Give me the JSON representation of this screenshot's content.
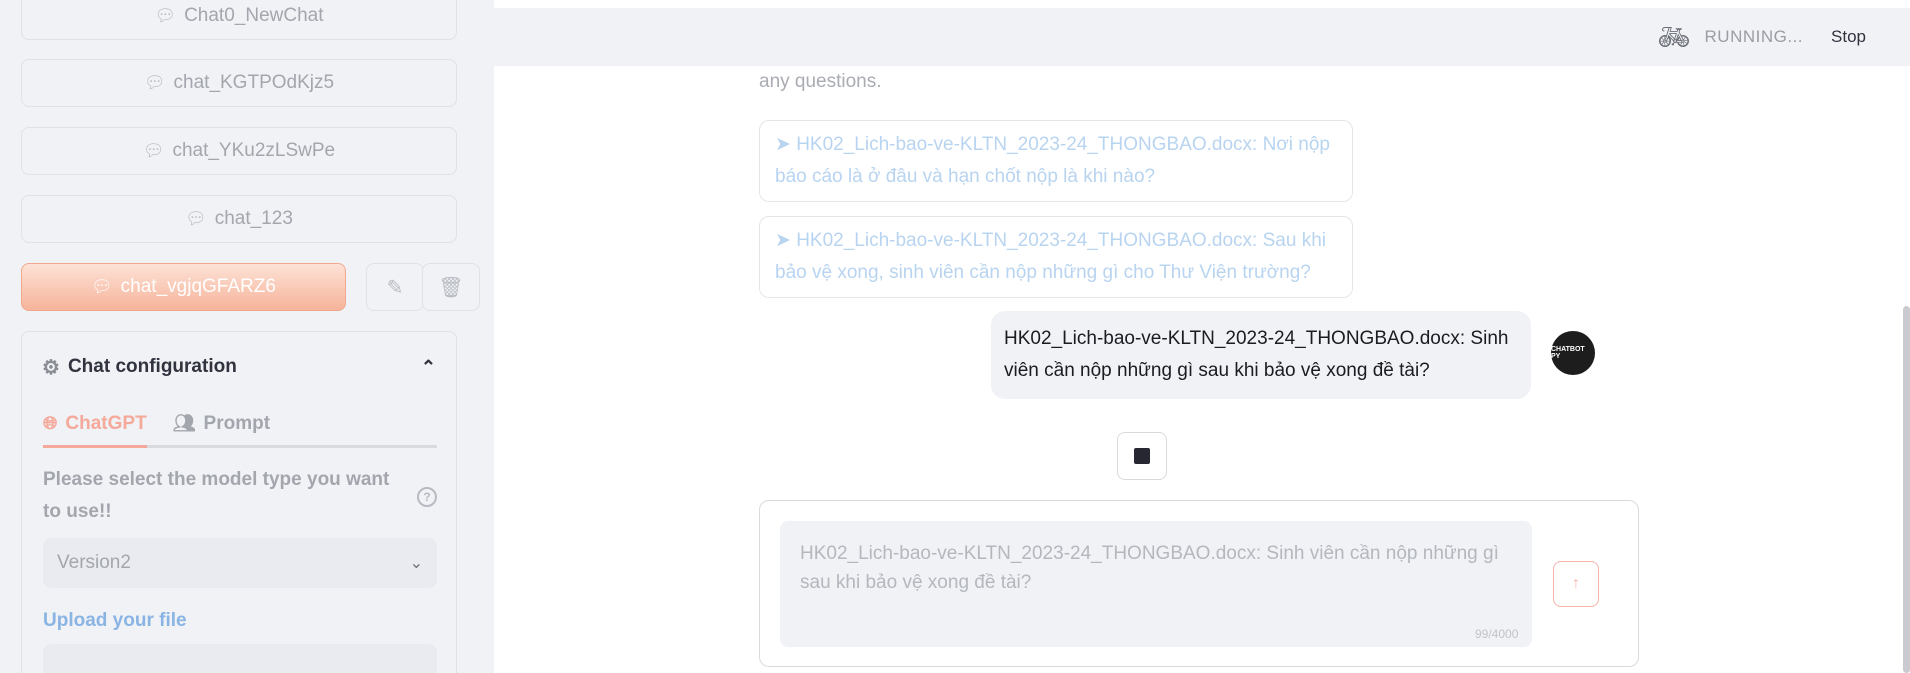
{
  "sidebar": {
    "chats": [
      {
        "label": "Chat0_NewChat",
        "icon": "chat-bubble-icon"
      },
      {
        "label": "chat_KGTPOdKjz5",
        "icon": "chat-bubble-icon"
      },
      {
        "label": "chat_YKu2zLSwPe",
        "icon": "chat-bubble-icon"
      },
      {
        "label": "chat_123",
        "icon": "chat-bubble-icon"
      }
    ],
    "active_chat": {
      "label": "chat_vgjqGFARZ6",
      "icon": "chat-bubble-icon"
    },
    "edit_icon": "edit-icon",
    "delete_icon": "trash-icon",
    "config": {
      "title": "Chat configuration",
      "tabs": [
        {
          "label": "ChatGPT",
          "icon": "globe-icon",
          "active": true
        },
        {
          "label": "Prompt",
          "icon": "users-icon",
          "active": false
        }
      ],
      "model_label": "Please select the model type you want to use!!",
      "help_glyph": "?",
      "model_value": "Version2",
      "upload_label": "Upload your file"
    }
  },
  "topbar": {
    "status": "RUNNING...",
    "stop_label": "Stop"
  },
  "chat": {
    "faded_text": "any questions.",
    "suggestions": [
      "➤ HK02_Lich-bao-ve-KLTN_2023-24_THONGBAO.docx: Nơi nộp báo cáo là ở đâu và hạn chốt nộp là khi nào?",
      "➤ HK02_Lich-bao-ve-KLTN_2023-24_THONGBAO.docx: Sau khi bảo vệ xong, sinh viên cần nộp những gì cho Thư Viện trường?"
    ],
    "user_message": "HK02_Lich-bao-ve-KLTN_2023-24_THONGBAO.docx: Sinh viên cần nộp những gì sau khi bảo vệ xong đề tài?",
    "avatar_label": "CHATBOT PY"
  },
  "input": {
    "value": "HK02_Lich-bao-ve-KLTN_2023-24_THONGBAO.docx: Sinh viên cần nộp những gì sau khi bảo vệ xong đề tài?",
    "counter": "99/4000",
    "send_icon": "arrow-up-icon"
  },
  "colors": {
    "accent": "#f5a99a",
    "active_chat_gradient_start": "#fde2d6",
    "active_chat_gradient_end": "#f6b49b",
    "link": "#8ab4e4"
  }
}
